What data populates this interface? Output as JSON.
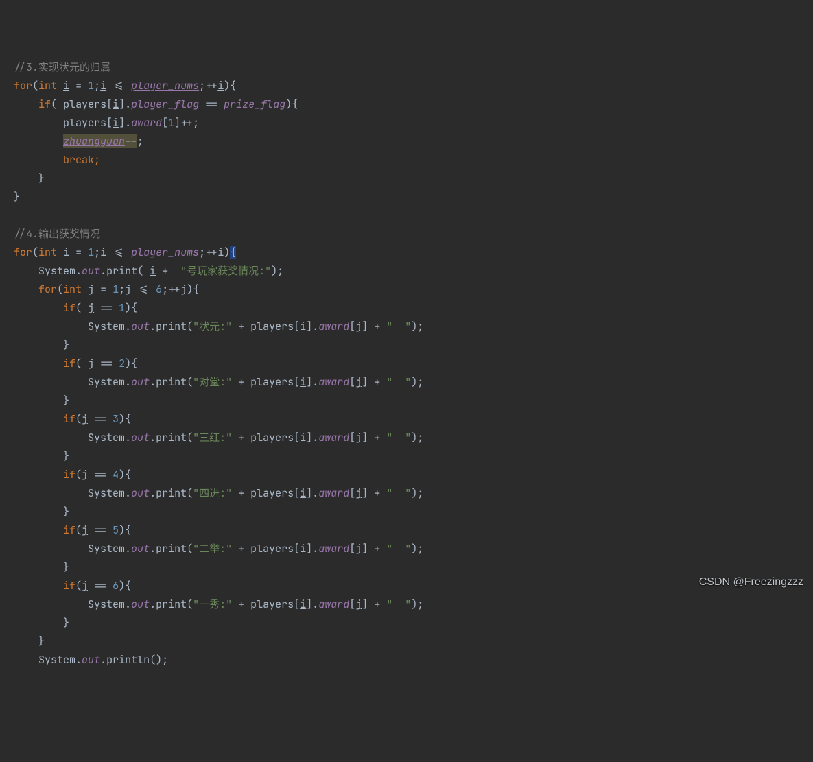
{
  "comments": {
    "c1": "//3.实现状元的归属",
    "c2": "//4.输出获奖情况"
  },
  "kw": {
    "for": "for",
    "int": "int",
    "if": "if",
    "break": "break"
  },
  "ident": {
    "i": "i",
    "j": "j",
    "players": "players",
    "System": "System",
    "print": "print",
    "println": "println"
  },
  "fields": {
    "player_nums": "player_nums",
    "player_flag": "player_flag",
    "prize_flag": "prize_flag",
    "award": "award",
    "zhuangyuan": "zhuangyuan",
    "out": "out"
  },
  "nums": {
    "n1": "1",
    "n2": "2",
    "n3": "3",
    "n4": "4",
    "n5": "5",
    "n6": "6"
  },
  "strings": {
    "player_award_header": "\"号玩家获奖情况:\"",
    "zhuangyuan": "\"状元:\"",
    "duitang": "\"对堂:\"",
    "sanhong": "\"三红:\"",
    "sijin": "\"四进:\"",
    "erju": "\"二举:\"",
    "yixiu": "\"一秀:\"",
    "space2": "\"  \""
  },
  "punct": {
    "lpar": "(",
    "rpar": ")",
    "lbrace": "{",
    "rbrace": "}",
    "lbracket": "[",
    "rbracket": "]",
    "semi": ";",
    "dot": ".",
    "assign": " = ",
    "le": " <= ",
    "eqeq": " == ",
    "incpre": "++",
    "incpost": "++",
    "decpost": "--",
    "plus": " + "
  },
  "watermark": "CSDN @Freezingzzz"
}
